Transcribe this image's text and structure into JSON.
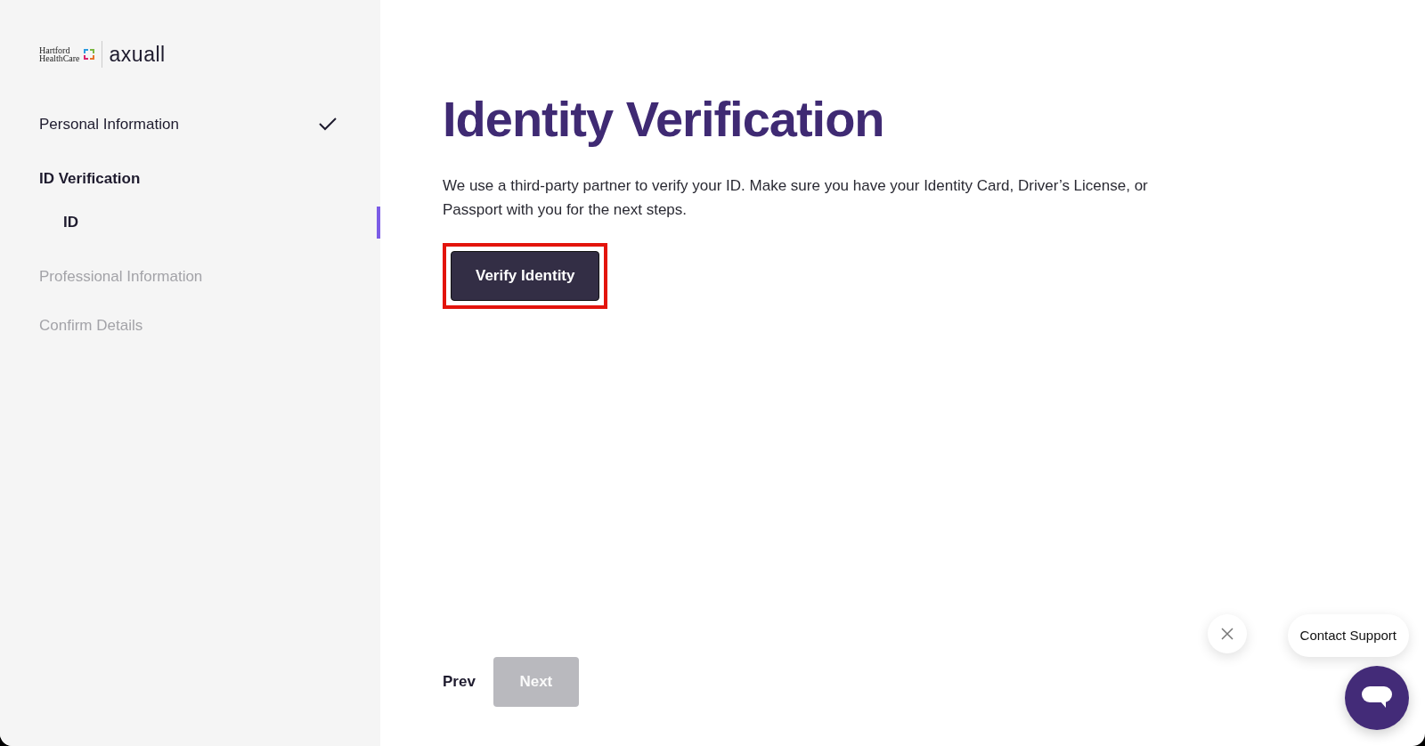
{
  "logo": {
    "partner": [
      "Hartford",
      "HealthCare"
    ],
    "brand": "axuall"
  },
  "steps": [
    {
      "label": "Personal Information",
      "completed": true,
      "current": false,
      "disabled": false
    },
    {
      "label": "ID Verification",
      "completed": false,
      "current": true,
      "disabled": false,
      "children": [
        {
          "label": "ID",
          "selected": true
        }
      ]
    },
    {
      "label": "Professional Information",
      "completed": false,
      "current": false,
      "disabled": true
    },
    {
      "label": "Confirm Details",
      "completed": false,
      "current": false,
      "disabled": true
    }
  ],
  "main": {
    "title": "Identity Verification",
    "description": "We use a third-party partner to verify your ID. Make sure you have your Identity Card, Driver’s License, or Passport with you for the next steps.",
    "action": {
      "label": "Verify Identity",
      "highlighted": true
    }
  },
  "footer": {
    "prev": {
      "label": "Prev"
    },
    "next": {
      "label": "Next",
      "disabled": true
    }
  },
  "support": {
    "label": "Contact Support"
  }
}
